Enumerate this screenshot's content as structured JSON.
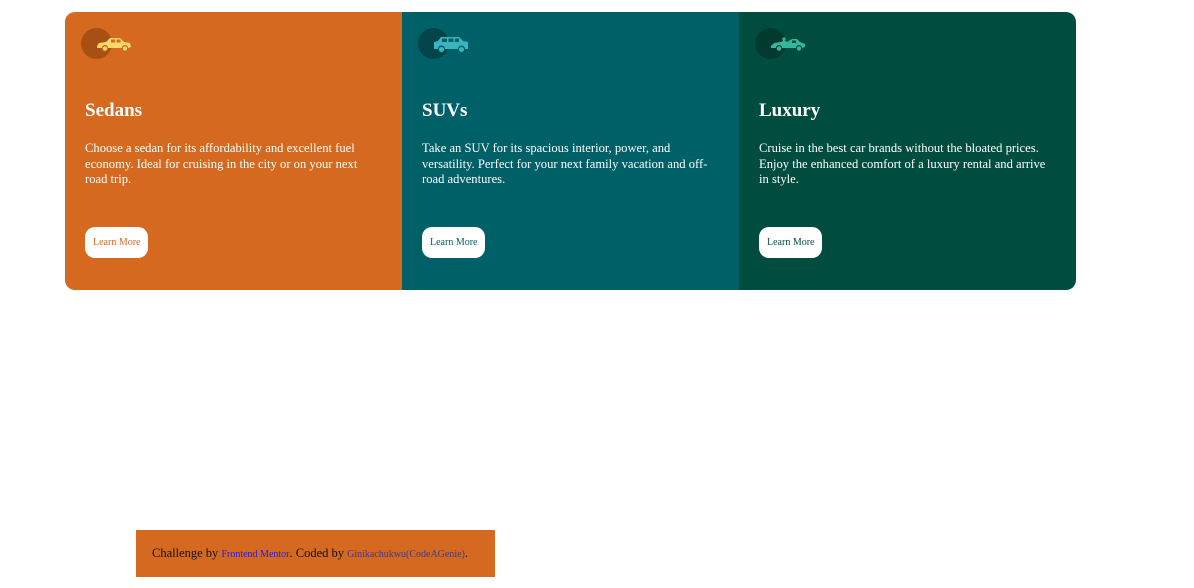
{
  "colors": {
    "sedans_bg": "#d4691f",
    "suvs_bg": "#006068",
    "luxury_bg": "#004d40",
    "sedans_icon": "#f9d86a",
    "suvs_icon": "#3bb4c0",
    "luxury_icon": "#36b79b"
  },
  "cards": [
    {
      "icon": "sedan-car-icon",
      "title": "Sedans",
      "description": "Choose a sedan for its affordability and excellent fuel economy. Ideal for cruising in the city or on your next road trip.",
      "button_label": "Learn More"
    },
    {
      "icon": "suv-car-icon",
      "title": "SUVs",
      "description": "Take an SUV for its spacious interior, power, and versatility. Perfect for your next family vacation and off-road adventures.",
      "button_label": "Learn More"
    },
    {
      "icon": "luxury-car-icon",
      "title": "Luxury",
      "description": "Cruise in the best car brands without the bloated prices. Enjoy the enhanced comfort of a luxury rental and arrive in style.",
      "button_label": "Learn More"
    }
  ],
  "attribution": {
    "prefix": "Challenge by ",
    "challenge_link": "Frontend Mentor",
    "middle": ". Coded by ",
    "author_link": "Ginikachukwu(CodeAGenie)",
    "suffix": "."
  }
}
